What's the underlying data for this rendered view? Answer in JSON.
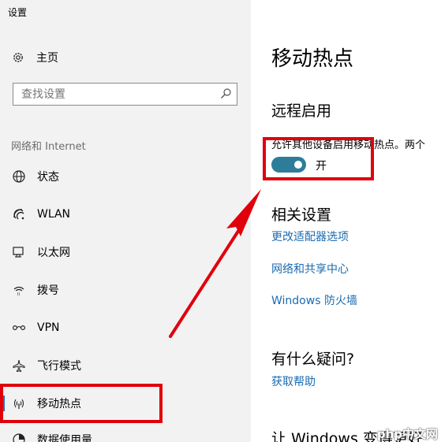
{
  "window": {
    "title": "设置"
  },
  "sidebar": {
    "home": {
      "label": "主页",
      "icon": "gear-icon"
    },
    "search": {
      "placeholder": "查找设置",
      "icon": "search-icon"
    },
    "section_label": "网络和 Internet",
    "items": [
      {
        "label": "状态",
        "icon": "globe-icon"
      },
      {
        "label": "WLAN",
        "icon": "wifi-icon"
      },
      {
        "label": "以太网",
        "icon": "ethernet-icon"
      },
      {
        "label": "拨号",
        "icon": "dialup-icon"
      },
      {
        "label": "VPN",
        "icon": "vpn-icon"
      },
      {
        "label": "飞行模式",
        "icon": "airplane-icon"
      },
      {
        "label": "移动热点",
        "icon": "hotspot-icon",
        "active": true
      },
      {
        "label": "数据使用量",
        "icon": "data-usage-icon"
      }
    ]
  },
  "main": {
    "title": "移动热点",
    "remote": {
      "heading": "远程启用",
      "description": "允许其他设备启用移动热点。两个",
      "toggle_state": "开",
      "toggle_on": true
    },
    "related": {
      "heading": "相关设置",
      "links": [
        "更改适配器选项",
        "网络和共享中心",
        "Windows 防火墙"
      ]
    },
    "questions": {
      "heading": "有什么疑问?",
      "link": "获取帮助"
    },
    "improve": {
      "heading": "让 Windows 变得更好"
    }
  },
  "watermark": "php中文网",
  "colors": {
    "sidebar_bg": "#f2f2f2",
    "accent": "#2d7d9a",
    "link": "#1a6bb0",
    "annotation_red": "#e0000c"
  }
}
